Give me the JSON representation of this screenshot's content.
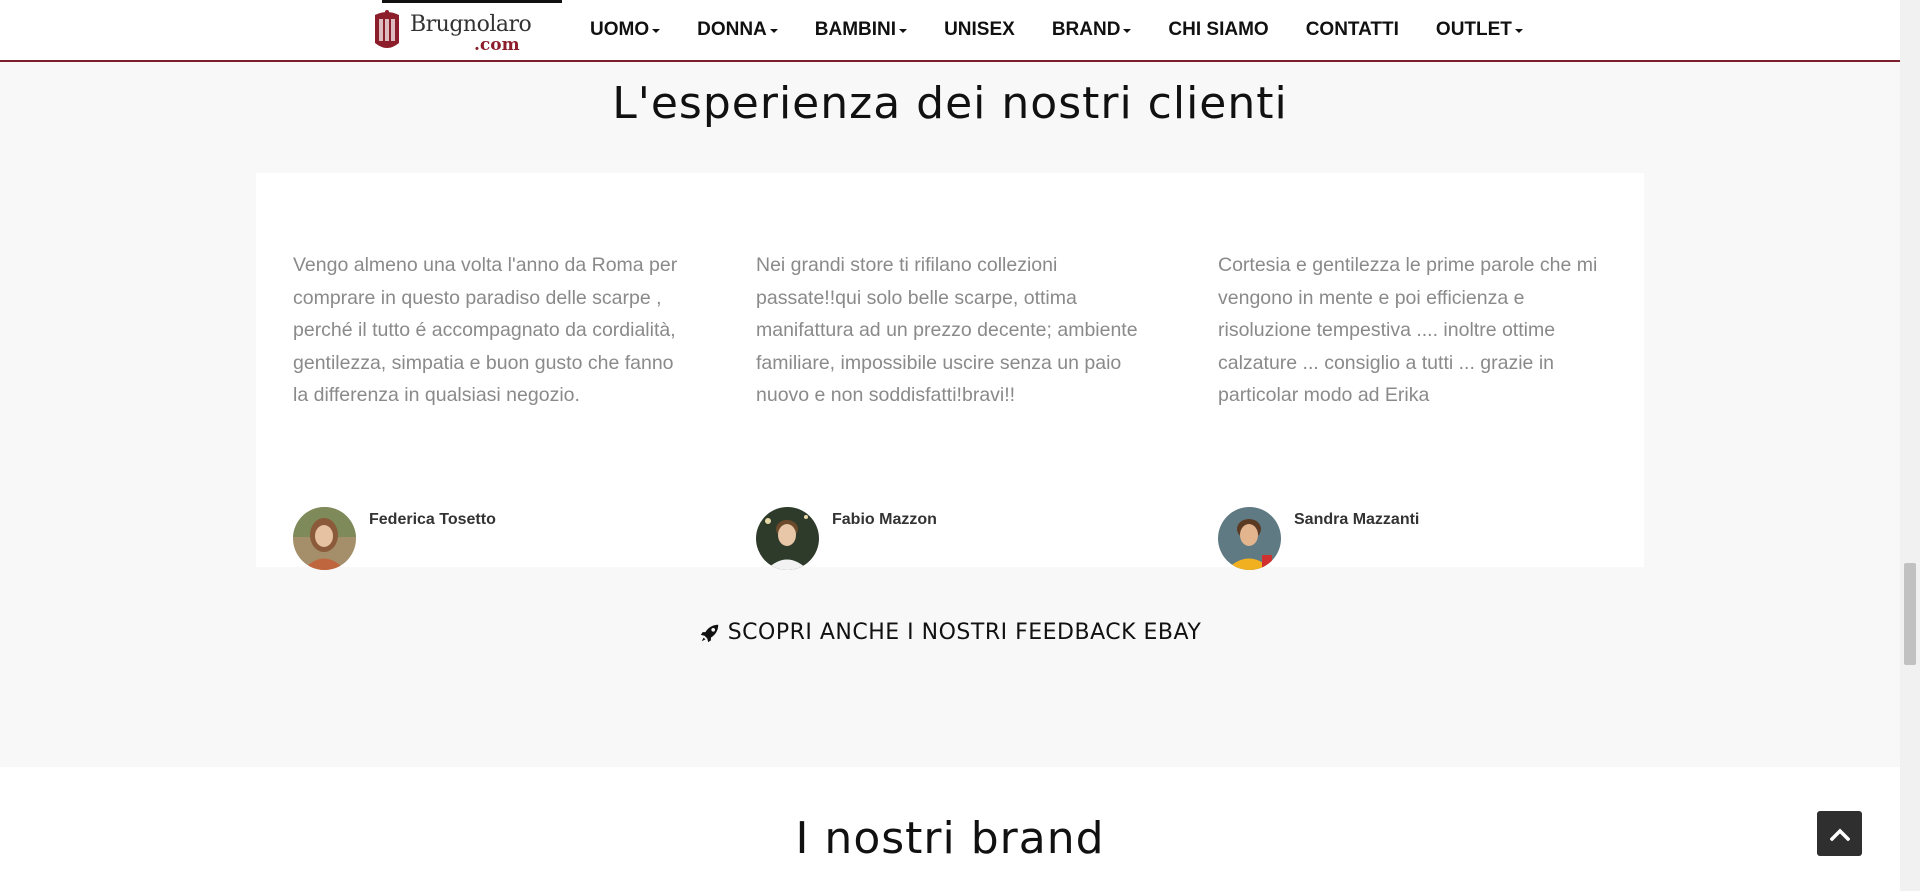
{
  "header": {
    "logo": {
      "name": "Brugnolaro",
      "suffix": ".com"
    },
    "nav": [
      {
        "label": "UOMO",
        "dropdown": true
      },
      {
        "label": "DONNA",
        "dropdown": true
      },
      {
        "label": "BAMBINI",
        "dropdown": true
      },
      {
        "label": "UNISEX",
        "dropdown": false
      },
      {
        "label": "BRAND",
        "dropdown": true
      },
      {
        "label": "CHI SIAMO",
        "dropdown": false
      },
      {
        "label": "CONTATTI",
        "dropdown": false
      },
      {
        "label": "OUTLET",
        "dropdown": true
      }
    ]
  },
  "testimonials": {
    "title": "L'esperienza dei nostri clienti",
    "items": [
      {
        "text": "Vengo almeno una volta l'anno da Roma per comprare in questo paradiso delle scarpe , perché il tutto é accompagnato da cordialità, gentilezza, simpatia e buon gusto che fanno la differenza in qualsiasi negozio.",
        "author": "Federica Tosetto"
      },
      {
        "text": "Nei grandi store ti rifilano collezioni passate!!qui solo belle scarpe, ottima manifattura ad un prezzo decente; ambiente familiare, impossibile uscire senza un paio nuovo e non soddisfatti!bravi!!",
        "author": "Fabio Mazzon"
      },
      {
        "text": "Cortesia e gentilezza le prime parole che mi vengono in mente e poi efficienza e risoluzione tempestiva .... inoltre ottime calzature ... consiglio a tutti ... grazie in particolar modo ad Erika",
        "author": "Sandra Mazzanti"
      }
    ],
    "feedback_link": "SCOPRI ANCHE I NOSTRI FEEDBACK EBAY",
    "feedback_icon": "rocket-icon"
  },
  "brands": {
    "title": "I nostri brand"
  },
  "colors": {
    "accent": "#7a1f2b",
    "text_muted": "#8a8a8a",
    "section_bg": "#f8f8f8"
  }
}
